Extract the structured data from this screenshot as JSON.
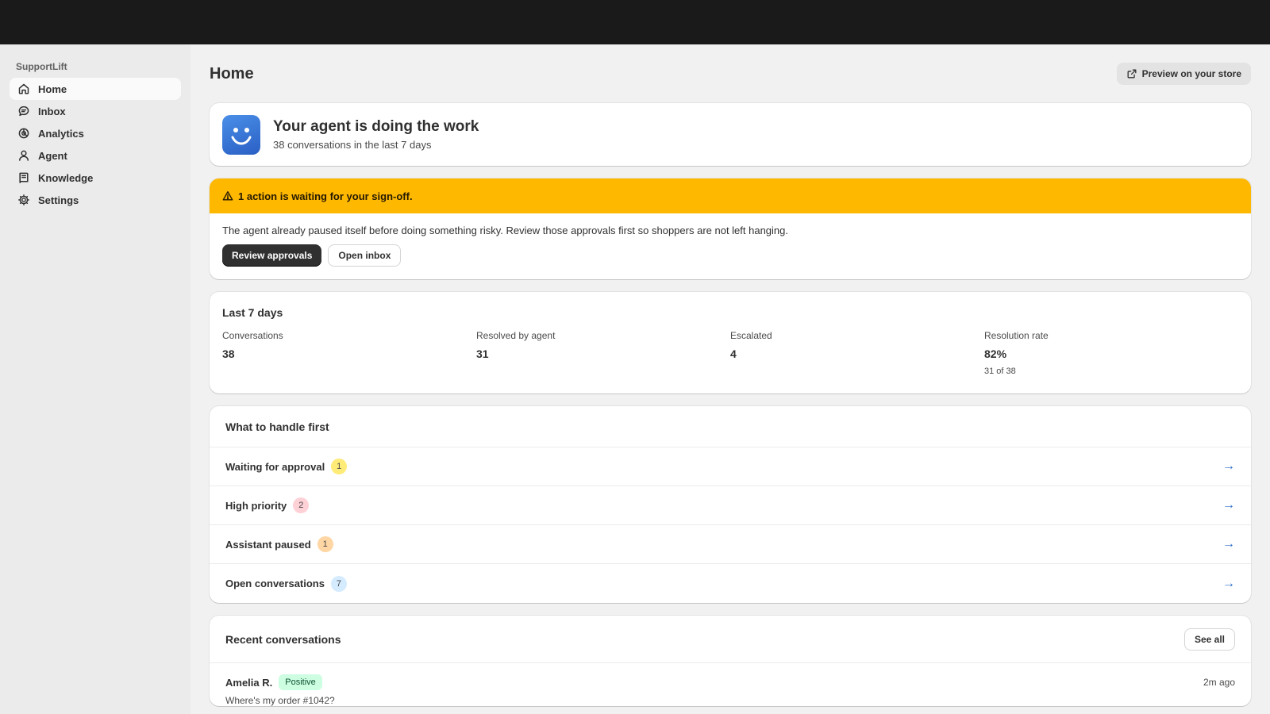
{
  "app": {
    "name": "SupportLift"
  },
  "sidebar": {
    "items": [
      {
        "label": "Home",
        "icon": "home-icon",
        "active": true
      },
      {
        "label": "Inbox",
        "icon": "chat-icon"
      },
      {
        "label": "Analytics",
        "icon": "analytics-icon"
      },
      {
        "label": "Agent",
        "icon": "person-icon"
      },
      {
        "label": "Knowledge",
        "icon": "book-icon"
      },
      {
        "label": "Settings",
        "icon": "gear-icon"
      }
    ]
  },
  "header": {
    "title": "Home",
    "preview_label": "Preview on your store"
  },
  "hero": {
    "title": "Your agent is doing the work",
    "subtitle": "38 conversations in the last 7 days"
  },
  "alert": {
    "title": "1 action is waiting for your sign-off.",
    "body": "The agent already paused itself before doing something risky. Review those approvals first so shoppers are not left hanging.",
    "primary_label": "Review approvals",
    "secondary_label": "Open inbox",
    "color": "#ffb800"
  },
  "stats": {
    "title": "Last 7 days",
    "items": [
      {
        "label": "Conversations",
        "value": "38",
        "note": ""
      },
      {
        "label": "Resolved by agent",
        "value": "31",
        "note": ""
      },
      {
        "label": "Escalated",
        "value": "4",
        "note": ""
      },
      {
        "label": "Resolution rate",
        "value": "82%",
        "note": "31 of 38"
      }
    ]
  },
  "handle_first": {
    "title": "What to handle first",
    "rows": [
      {
        "label": "Waiting for approval",
        "count": "1",
        "color": "#ffeb78",
        "arrow": "→"
      },
      {
        "label": "High priority",
        "count": "2",
        "color": "#fed1d7",
        "arrow": "→"
      },
      {
        "label": "Assistant paused",
        "count": "1",
        "color": "#ffd6a4",
        "arrow": "→"
      },
      {
        "label": "Open conversations",
        "count": "7",
        "color": "#d5ebff",
        "arrow": "→"
      }
    ]
  },
  "recent": {
    "title": "Recent conversations",
    "see_all_label": "See all",
    "rows": [
      {
        "name": "Amelia R.",
        "sentiment": "Positive",
        "time": "2m ago",
        "message": "Where's my order #1042?"
      }
    ]
  }
}
